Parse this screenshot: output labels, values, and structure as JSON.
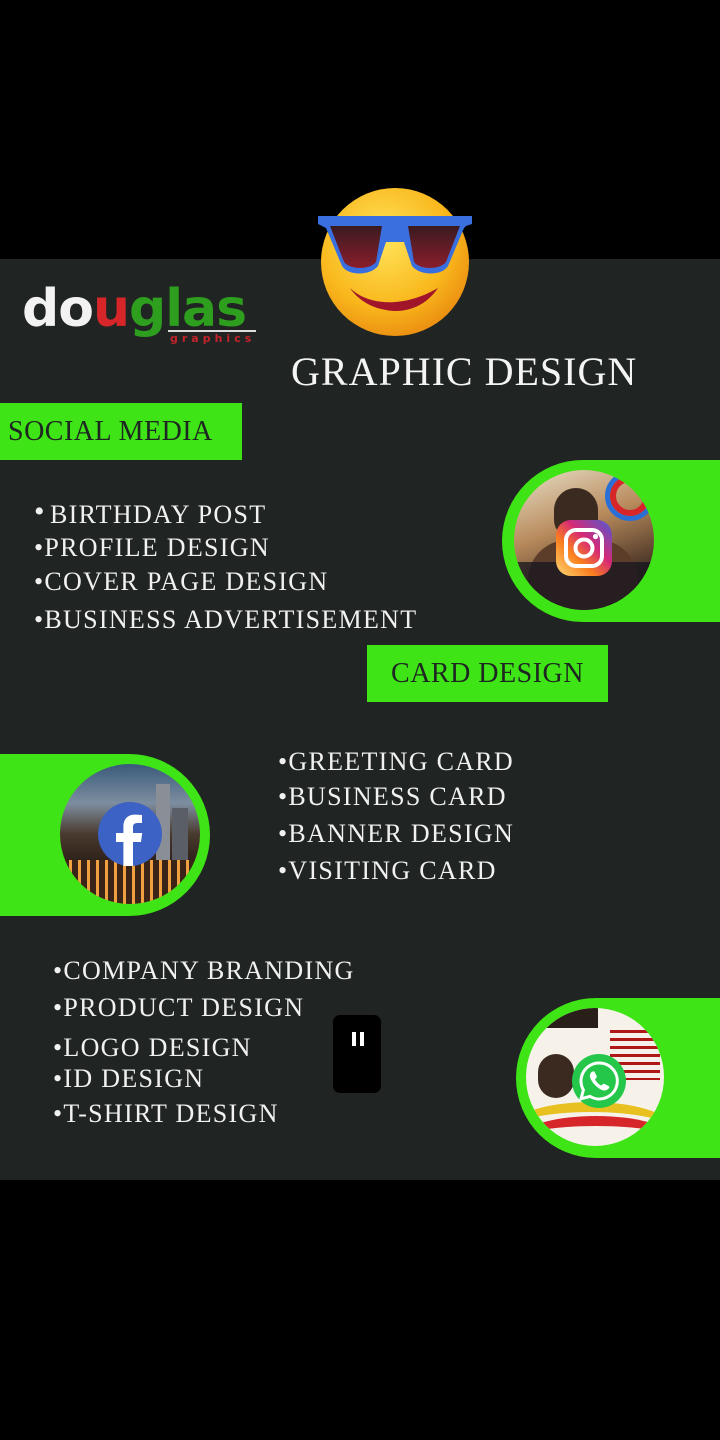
{
  "brand": {
    "logo_part1": "do",
    "logo_part2": "u",
    "logo_part3": "glas",
    "logo_sub": "graphics"
  },
  "headline": "GRAPHIC DESIGN",
  "social_media": {
    "label": "SOCIAL MEDIA",
    "items": [
      "BIRTHDAY POST",
      "•PROFILE DESIGN",
      "•COVER PAGE DESIGN",
      "•BUSINESS ADVERTISEMENT"
    ]
  },
  "card_design": {
    "label": "CARD DESIGN",
    "items": [
      "•GREETING CARD",
      "•BUSINESS CARD",
      "•BANNER DESIGN",
      "•VISITING CARD"
    ]
  },
  "other_services": {
    "items": [
      "•COMPANY BRANDING",
      "•PRODUCT DESIGN",
      "•LOGO DESIGN",
      "•ID DESIGN",
      "•T-SHIRT DESIGN"
    ]
  },
  "icons": {
    "emoji": "sunglasses-emoji-icon",
    "instagram": "instagram-icon",
    "facebook": "facebook-icon",
    "whatsapp": "whatsapp-icon",
    "pause": "pause-icon"
  },
  "colors": {
    "accent": "#3ee416",
    "background": "#202423"
  }
}
